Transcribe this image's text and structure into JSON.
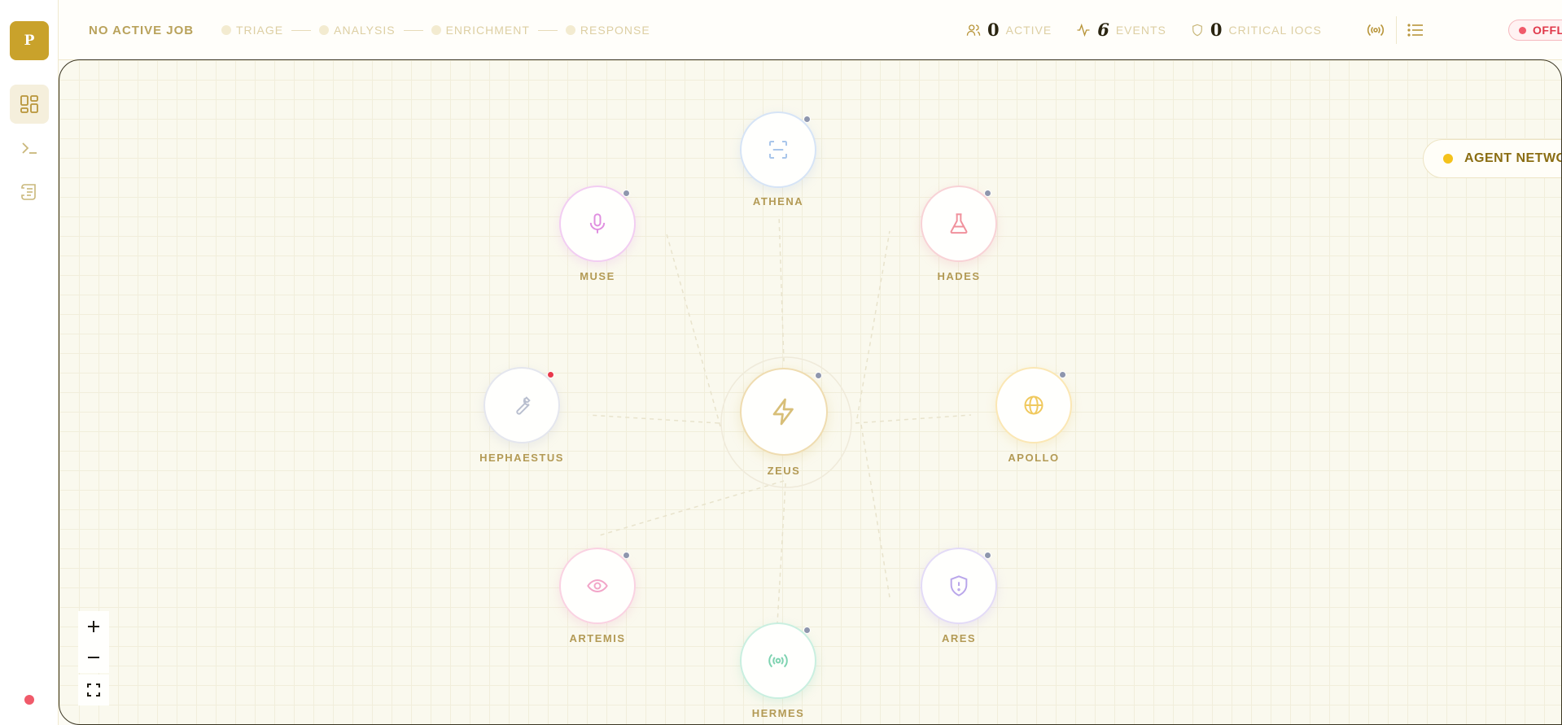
{
  "app": {
    "logo_letter": "P"
  },
  "sidebar": {
    "items": [
      {
        "name": "dashboard",
        "icon": "grid-icon",
        "active": true
      },
      {
        "name": "terminal",
        "icon": "terminal-icon",
        "active": false
      },
      {
        "name": "logs",
        "icon": "scroll-icon",
        "active": false
      }
    ],
    "status_color": "#f05a6a"
  },
  "header": {
    "job_title": "NO ACTIVE JOB",
    "stages": [
      "TRIAGE",
      "ANALYSIS",
      "ENRICHMENT",
      "RESPONSE"
    ],
    "stats": [
      {
        "icon": "users-icon",
        "value": "0",
        "label": "ACTIVE"
      },
      {
        "icon": "activity-icon",
        "value": "6",
        "label": "EVENTS"
      },
      {
        "icon": "shield-icon",
        "value": "0",
        "label": "CRITICAL IOCS"
      }
    ],
    "status": "OFFLINE"
  },
  "network": {
    "badge": "AGENT NETWORK",
    "accent": "#f4c21b",
    "agents": [
      {
        "name": "ZEUS",
        "icon": "lightning-icon",
        "color": "#d8bf78",
        "status": "idle"
      },
      {
        "name": "ATHENA",
        "icon": "scan-icon",
        "color": "#a9c6ea",
        "status": "idle"
      },
      {
        "name": "MUSE",
        "icon": "microphone-icon",
        "color": "#e7a1e6",
        "status": "idle"
      },
      {
        "name": "HADES",
        "icon": "flask-icon",
        "color": "#f2a6ae",
        "status": "idle"
      },
      {
        "name": "HEPHAESTUS",
        "icon": "wrench-icon",
        "color": "#b9bfcf",
        "status": "error"
      },
      {
        "name": "APOLLO",
        "icon": "globe-icon",
        "color": "#f0c95e",
        "status": "idle"
      },
      {
        "name": "ARTEMIS",
        "icon": "eye-icon",
        "color": "#f2a5c8",
        "status": "idle"
      },
      {
        "name": "ARES",
        "icon": "shield-alert-icon",
        "color": "#c9b7ef",
        "status": "idle"
      },
      {
        "name": "HERMES",
        "icon": "broadcast-icon",
        "color": "#8fd8bb",
        "status": "idle"
      }
    ],
    "status_colors": {
      "idle": "#8e96ad",
      "error": "#e8384a"
    }
  },
  "zoom_controls": [
    "zoom-in",
    "zoom-out",
    "fit-view"
  ]
}
